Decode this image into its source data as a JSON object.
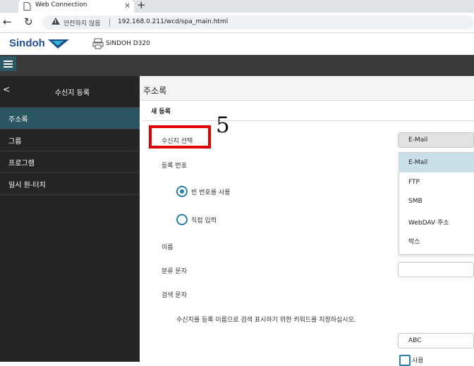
{
  "browser": {
    "tab_title": "Web Connection",
    "tab_close": "×",
    "new_tab": "+",
    "security_label": "안전하지 않음",
    "url": "192.168.0.211/wcd/spa_main.html"
  },
  "app": {
    "logo_text": "Sindoh",
    "device_name": "SINDOH D320",
    "brand_color": "#1f4f8e"
  },
  "sidebar": {
    "back_label": "<",
    "title": "수신지 등록",
    "items": [
      {
        "label": "주소록",
        "active": true
      },
      {
        "label": "그룹"
      },
      {
        "label": "프로그램"
      },
      {
        "label": "일시 원-터치"
      }
    ]
  },
  "main": {
    "title": "주소록",
    "section": "새 등록",
    "destination_label": "수신지 선택",
    "step_number": "5",
    "reg_no_label": "등록 번호",
    "radio_empty_label": "빈 번호를 사용",
    "radio_direct_label": "직접 입력",
    "name_label": "이름",
    "class_label": "분류 문자",
    "search_label": "검색 문자",
    "hint": "수신지를 등록 이름으로 검색 표시하기 위한 키워드를 지정하십시오.",
    "select_value": "E-Mail",
    "options": [
      "E-Mail",
      "FTP",
      "SMB",
      "WebDAV 주소",
      "박스"
    ],
    "abc_value": "ABC",
    "use_label": "사용",
    "accent_color": "#2a7fa8",
    "highlight_color": "#e00000"
  }
}
